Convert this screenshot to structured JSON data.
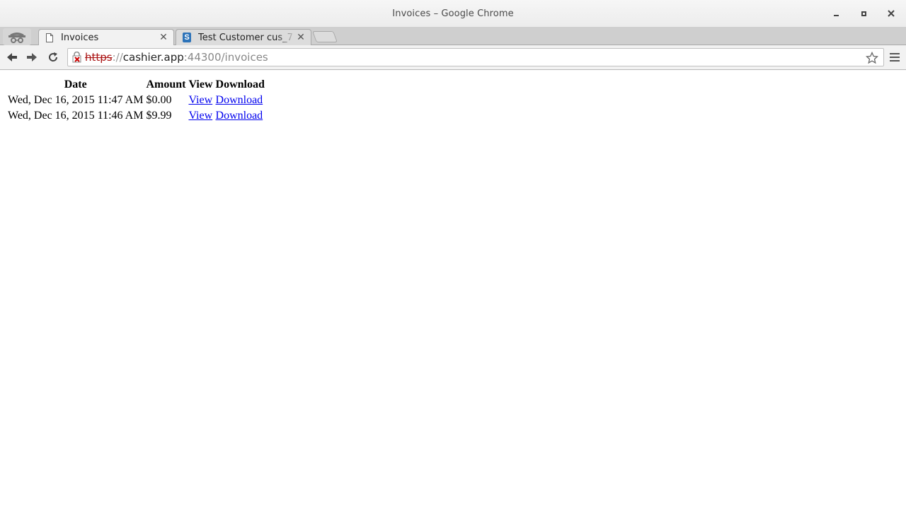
{
  "window": {
    "title": "Invoices – Google Chrome"
  },
  "tabs": [
    {
      "label": "Invoices",
      "favicon": "page-icon",
      "active": true
    },
    {
      "label": "Test Customer cus_7",
      "favicon": "stripe-icon",
      "active": false
    }
  ],
  "address_bar": {
    "scheme": "https",
    "separator": "://",
    "host": "cashier.app",
    "port_path": ":44300/invoices",
    "security": "insecure"
  },
  "table": {
    "headers": [
      "Date",
      "Amount",
      "View",
      "Download"
    ],
    "rows": [
      {
        "date": "Wed, Dec 16, 2015 11:47 AM",
        "amount": "$0.00",
        "view": "View",
        "download": "Download"
      },
      {
        "date": "Wed, Dec 16, 2015 11:46 AM",
        "amount": "$9.99",
        "view": "View",
        "download": "Download"
      }
    ]
  },
  "colors": {
    "link": "#0000ee",
    "insecure_scheme": "#aa1111"
  }
}
